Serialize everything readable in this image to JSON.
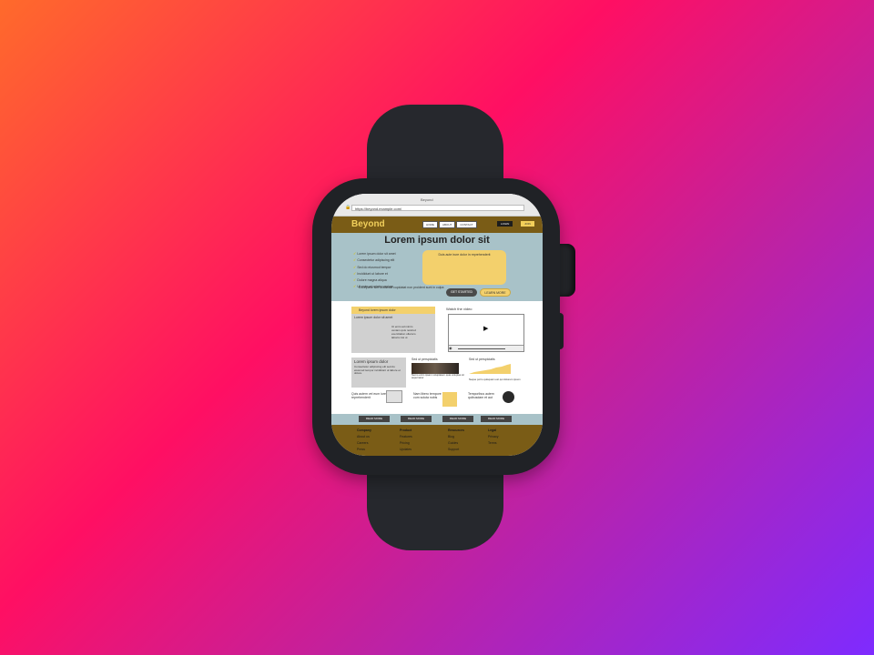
{
  "browser": {
    "tab_title": "Beyond",
    "url": "https://beyond.example.com/"
  },
  "site": {
    "logo": "Beyond",
    "nav": [
      "HOME",
      "ABOUT",
      "CONTACT"
    ],
    "login_label": "LOGIN",
    "register_label": "JOIN"
  },
  "hero": {
    "title": "Lorem ipsum dolor sit",
    "features": [
      "Lorem ipsum dolor sit amet",
      "Consectetur adipiscing elit",
      "Sed do eiusmod tempor",
      "Incididunt ut labore et",
      "Dolore magna aliqua",
      "Ut enim ad minim veniam"
    ],
    "box_text": "Duis aute irure dolor in reprehenderit",
    "note": "Excepteur sint occaecat cupidatat non proident sunt in culpa",
    "btn_primary": "GET STARTED",
    "btn_secondary": "LEARN MORE"
  },
  "cards": {
    "card1_title": "Beyond lorem ipsum dolor",
    "card1_sub": "Lorem ipsum dolor sit amet",
    "card1_lines": [
      "Ut enim ad minim",
      "veniam quis nostrud",
      "exercitation ullamco",
      "laboris nisi ut"
    ],
    "video_title": "Watch the video",
    "card2_title": "Lorem ipsum dolor",
    "card2_text": "Consectetur adipiscing elit sed do eiusmod tempor incididunt ut labore et dolore",
    "card3_title": "Sed ut perspiciatis",
    "card3_text": "Nemo enim ipsam voluptatem quia voluptas sit aspernatur",
    "card4_title": "Sed ut perspiciatis",
    "card4_text": "Neque porro quisquam est qui dolorem ipsum",
    "row3": [
      "Quis autem vel eum iure reprehenderit",
      "Nam libero tempore cum soluta nobis",
      "Temporibus autem quibusdam et aut"
    ]
  },
  "strip_buttons": [
    "READ MORE",
    "READ MORE",
    "READ MORE",
    "READ MORE"
  ],
  "footer": {
    "columns": [
      {
        "heading": "Company",
        "links": [
          "About us",
          "Careers",
          "Press"
        ]
      },
      {
        "heading": "Product",
        "links": [
          "Features",
          "Pricing",
          "Updates"
        ]
      },
      {
        "heading": "Resources",
        "links": [
          "Blog",
          "Guides",
          "Support"
        ]
      },
      {
        "heading": "Legal",
        "links": [
          "Privacy",
          "Terms"
        ]
      }
    ]
  },
  "colors": {
    "brand_brown": "#7a5c16",
    "accent_yellow": "#f3d06c",
    "hero_blue": "#a8c2c8"
  }
}
